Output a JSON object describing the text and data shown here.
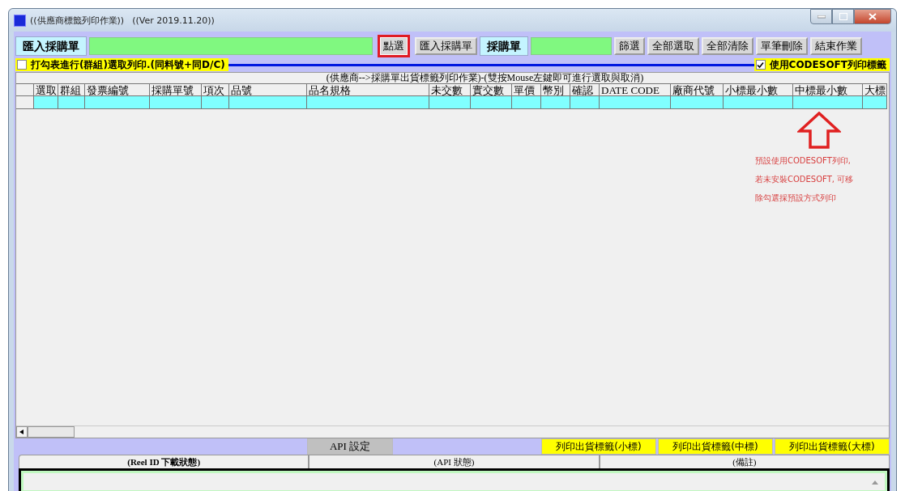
{
  "window": {
    "title": "((供應商標籤列印作業))",
    "version": "((Ver 2019.11.20))"
  },
  "toolbar": [
    {
      "kind": "label",
      "text": "匯入採購單"
    },
    {
      "kind": "field"
    },
    {
      "kind": "button",
      "text": "點選",
      "highlighted": true
    },
    {
      "kind": "button",
      "text": "匯入採購單",
      "highlighted": false
    },
    {
      "kind": "label",
      "text": "採購單"
    },
    {
      "kind": "field"
    },
    {
      "kind": "button",
      "text": "篩選",
      "highlighted": false
    },
    {
      "kind": "button",
      "text": "全部選取",
      "highlighted": false
    },
    {
      "kind": "button",
      "text": "全部清除",
      "highlighted": false
    },
    {
      "kind": "button",
      "text": "單筆刪除",
      "highlighted": false
    },
    {
      "kind": "button",
      "text": "結束作業",
      "highlighted": false
    }
  ],
  "group_print_option": {
    "label": "打勾表進行(群組)選取列印.(同料號+同D/C)",
    "checked": false
  },
  "codesoft_option": {
    "label": "使用CODESOFT列印標籤",
    "checked": true
  },
  "table": {
    "caption": "(供應商-->採購單出貨標籤列印作業)-(雙按Mouse左鍵即可進行選取與取消)",
    "columns": [
      "選取",
      "群組",
      "發票編號",
      "採購單號",
      "項次",
      "品號",
      "品名規格",
      "未交數",
      "實交數",
      "單價",
      "幣別",
      "確認",
      "DATE CODE",
      "廠商代號",
      "小標最小數",
      "中標最小數",
      "大標"
    ]
  },
  "note": [
    "預設使用CODESOFT列印,",
    "若未安裝CODESOFT, 可移",
    "除勾選採預設方式列印"
  ],
  "bottom_buttons": [
    {
      "kind": "plain",
      "text": "API 設定"
    },
    {
      "kind": "print",
      "text": "列印出貨標籤(小標)"
    },
    {
      "kind": "print",
      "text": "列印出貨標籤(中標)"
    },
    {
      "kind": "print",
      "text": "列印出貨標籤(大標)"
    }
  ],
  "tabs": [
    {
      "label": "(Reel ID 下載狀態)",
      "selected": true
    },
    {
      "label": "(API 狀態)",
      "selected": false
    },
    {
      "label": "(備註)",
      "selected": false
    }
  ]
}
